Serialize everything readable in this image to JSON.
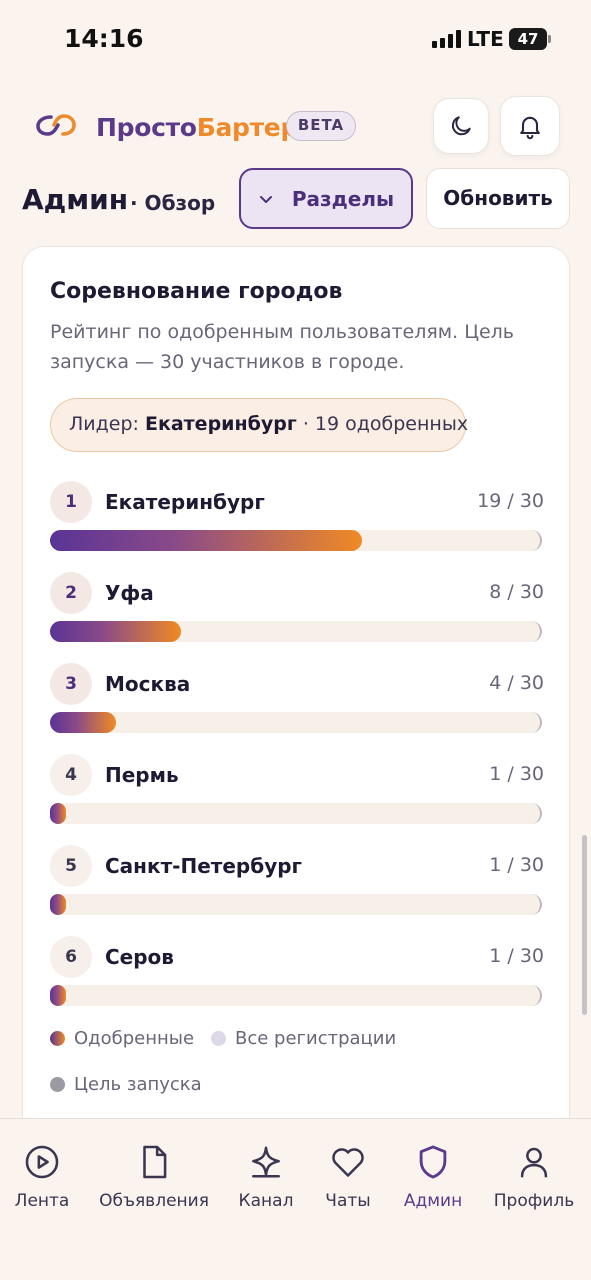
{
  "status_bar": {
    "time": "14:16",
    "network": "LTE",
    "battery": "47"
  },
  "header": {
    "brand_part1": "Просто",
    "brand_part2": "Бартер",
    "beta": "BETA",
    "icons": [
      "moon-icon",
      "bell-icon"
    ]
  },
  "page": {
    "title": "Админ",
    "subtitle": "· Обзор",
    "sections_label": "Разделы",
    "refresh_label": "Обновить"
  },
  "card": {
    "title": "Соревнование городов",
    "description": "Рейтинг по одобренным пользователям. Цель запуска — 30 участников в городе.",
    "leader_prefix": "Лидер: ",
    "leader_name": "Екатеринбург",
    "leader_suffix": " · 19 одобренных",
    "goal": 30,
    "cities": [
      {
        "rank": "1",
        "name": "Екатеринбург",
        "count": "19 / 30",
        "approved": 19
      },
      {
        "rank": "2",
        "name": "Уфа",
        "count": "8 / 30",
        "approved": 8
      },
      {
        "rank": "3",
        "name": "Москва",
        "count": "4 / 30",
        "approved": 4
      },
      {
        "rank": "4",
        "name": "Пермь",
        "count": "1 / 30",
        "approved": 1
      },
      {
        "rank": "5",
        "name": "Санкт-Петербург",
        "count": "1 / 30",
        "approved": 1
      },
      {
        "rank": "6",
        "name": "Серов",
        "count": "1 / 30",
        "approved": 1
      }
    ],
    "legend": {
      "approved": "Одобренные",
      "all": "Все регистрации",
      "goal": "Цель запуска"
    }
  },
  "colors": {
    "brand_purple": "#5b3a8a",
    "brand_orange": "#ef8a2a",
    "background": "#fbf4ee"
  },
  "bottom_nav": [
    {
      "label": "Лента",
      "icon": "play-circle-icon"
    },
    {
      "label": "Объявления",
      "icon": "document-icon"
    },
    {
      "label": "Канал",
      "icon": "sparkle-icon"
    },
    {
      "label": "Чаты",
      "icon": "heart-icon"
    },
    {
      "label": "Админ",
      "icon": "shield-icon",
      "active": true
    },
    {
      "label": "Профиль",
      "icon": "user-icon"
    }
  ]
}
